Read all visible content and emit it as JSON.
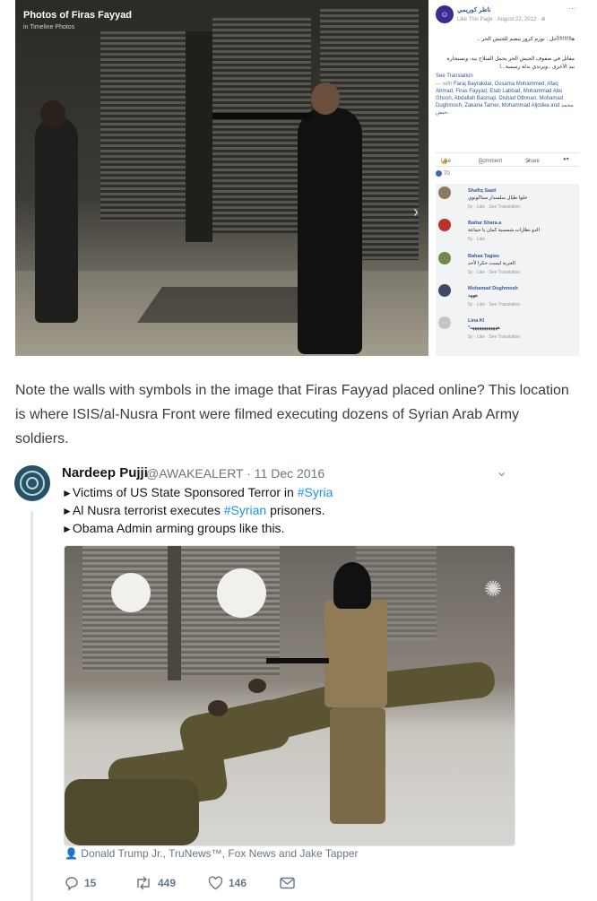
{
  "facebook_post": {
    "photo_title": "Photos of Firas Fayyad",
    "photo_subtitle": "in Timeline Photos",
    "page_name": "ناظر كوريمي",
    "page_meta": "Like This Page · August 22, 2012 · ⊕",
    "post_line1": "ها!!!!!!!!أجل : نورم كروز ينضم للجيش الحر ..",
    "post_line2": "مقاتل في صفوف الجيش الحر يحمل السلاح بيد، وبسيجارة بيد الأخرى ..ويرتدي بدلة رسمية ..!",
    "see_translation": "See Translation",
    "tagged_prefix": "— with",
    "tagged_names": "Faraj Bayrakdar, Ossama Mohammed, Afaq Ahmad, Firas Fayyad, Etab Labbad, Mohammad Abu Ghosh, Abdallah Basmaji, Dishad Othman, Mohamad Dughmosh, Zakaria Tamer, Mohammad Aljodea and محمد حبش.",
    "actions": {
      "like": "Like",
      "comment": "Comment",
      "share": "Share"
    },
    "reactions_count": "70",
    "comments": [
      {
        "name": "Shafiq Saati",
        "text": "خلوا طيال سلسدار ستاكونوي",
        "links": "5y · Like · See Translation",
        "avatar_color": "#8d7a62"
      },
      {
        "name": "Battar Shara.a",
        "text": "الدو نظارات شمسية كمان يا جماعة",
        "links": "5y · Like",
        "avatar_color": "#b8322a"
      },
      {
        "name": "Bahaa Tagias",
        "text": "الحرية ليست حكرا لأحد",
        "links": "5y · Like · See Translation",
        "avatar_color": "#6f8a4e"
      },
      {
        "name": "Mohamad Dughmosh",
        "text": "هههه",
        "links": "5y · Like · See Translation",
        "avatar_color": "#3f4a66"
      },
      {
        "name": "Lina Kl",
        "text": "*ههههههههههههه",
        "links": "5y · Like · See Translation",
        "avatar_color": "#c4c4c4"
      }
    ]
  },
  "article": {
    "note": "Note the walls with symbols in the image that Firas Fayyad placed online? This location is where ISIS/al-Nusra Front were filmed executing dozens of Syrian Arab Army soldiers."
  },
  "tweet": {
    "author_name": "Nardeep Pujji",
    "author_handle": "@AWAKEALERT · 11 Dec 2016",
    "line1_text": "Victims of US State Sponsored Terror in ",
    "line1_tag": "#Syria",
    "line2_text_a": "Al Nusra terrorist executes ",
    "line2_tag": "#Syrian",
    "line2_text_b": " prisoners.",
    "line3_text": "Obama Admin arming groups like this.",
    "media_credit": "Donald Trump Jr., TruNews™, Fox News and Jake Tapper",
    "replies": "15",
    "retweets": "449",
    "likes": "146"
  },
  "colors": {
    "link": "#1b95e0",
    "muted": "#657786",
    "fb_link": "#365899"
  }
}
